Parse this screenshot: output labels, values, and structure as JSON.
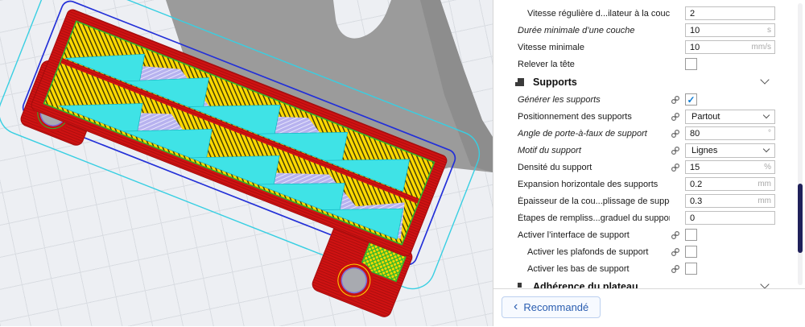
{
  "colors": {
    "wall_red": "#cf1212",
    "infill_yellow": "#ffd900",
    "support_cyan": "#3fe3e6",
    "support_interface_lavender": "#b7b2ef",
    "adhesion_brim_blue": "#2330d8",
    "skirt_cyan": "#38cfe2",
    "interface_green": "#2db52d",
    "shadow_gray": "#9b9b9b",
    "accent_blue": "#2a5db0",
    "check_blue": "#0b7bd4",
    "scroll_thumb_navy": "#20215a"
  },
  "panel": {
    "rows": [
      {
        "type": "number",
        "label": "Vitesse régulière d...ilateur à la couche",
        "value": "2",
        "unit": "",
        "italic": false,
        "link": false,
        "indent": 1
      },
      {
        "type": "number",
        "label": "Durée minimale d’une couche",
        "value": "10",
        "unit": "s",
        "italic": true,
        "link": false,
        "indent": 0
      },
      {
        "type": "number",
        "label": "Vitesse minimale",
        "value": "10",
        "unit": "mm/s",
        "italic": false,
        "link": false,
        "indent": 0
      },
      {
        "type": "checkbox",
        "label": "Relever la tête",
        "checked": false,
        "italic": false,
        "link": false,
        "indent": 0
      },
      {
        "type": "category",
        "label": "Supports",
        "icon": "supports"
      },
      {
        "type": "checkbox",
        "label": "Générer les supports",
        "checked": true,
        "italic": true,
        "link": true,
        "indent": 0
      },
      {
        "type": "select",
        "label": "Positionnement des supports",
        "value": "Partout",
        "italic": false,
        "link": true,
        "indent": 0
      },
      {
        "type": "number",
        "label": "Angle de porte-à-faux de support",
        "value": "80",
        "unit": "°",
        "italic": true,
        "link": true,
        "indent": 0
      },
      {
        "type": "select",
        "label": "Motif du support",
        "value": "Lignes",
        "italic": true,
        "link": true,
        "indent": 0
      },
      {
        "type": "number",
        "label": "Densité du support",
        "value": "15",
        "unit": "%",
        "italic": false,
        "link": true,
        "indent": 0
      },
      {
        "type": "number",
        "label": "Expansion horizontale des supports",
        "value": "0.2",
        "unit": "mm",
        "italic": false,
        "link": false,
        "indent": 0
      },
      {
        "type": "number",
        "label": "Épaisseur de la cou...plissage de support",
        "value": "0.3",
        "unit": "mm",
        "italic": false,
        "link": false,
        "indent": 0
      },
      {
        "type": "number",
        "label": "Étapes de rempliss...graduel du support",
        "value": "0",
        "unit": "",
        "italic": false,
        "link": false,
        "indent": 0
      },
      {
        "type": "checkbox",
        "label": "Activer l’interface de support",
        "checked": false,
        "italic": false,
        "link": true,
        "indent": 0
      },
      {
        "type": "checkbox",
        "label": "Activer les plafonds de support",
        "checked": false,
        "italic": false,
        "link": true,
        "indent": 1
      },
      {
        "type": "checkbox",
        "label": "Activer les bas de support",
        "checked": false,
        "italic": false,
        "link": true,
        "indent": 1
      },
      {
        "type": "category",
        "label": "Adhérence du plateau",
        "icon": "adhesion"
      }
    ]
  },
  "footer": {
    "back_label": "Recommandé",
    "back_chevron": "‹"
  }
}
